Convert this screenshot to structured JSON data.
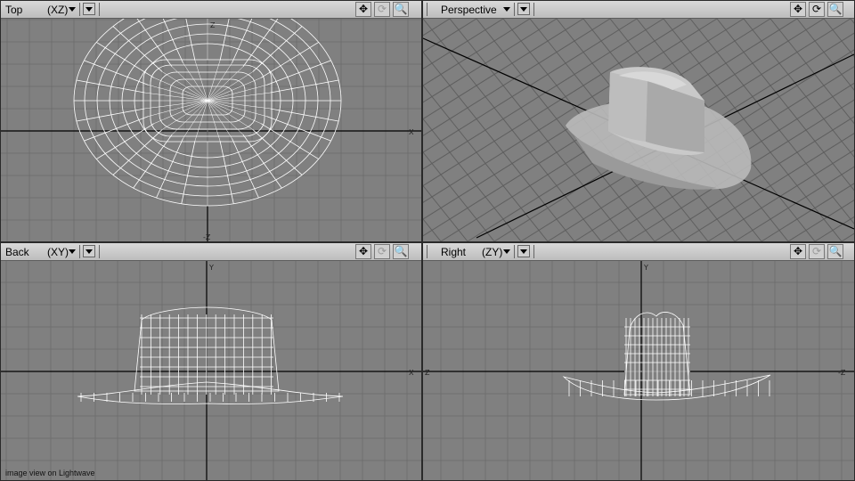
{
  "viewports": {
    "top": {
      "name": "Top",
      "axes": "(XZ)"
    },
    "persp": {
      "name": "Perspective",
      "axes": ""
    },
    "back": {
      "name": "Back",
      "axes": "(XY)"
    },
    "right": {
      "name": "Right",
      "axes": "(ZY)"
    }
  },
  "tools": {
    "move": "✥",
    "rotate": "⟳",
    "zoom": "🔍"
  },
  "axis_labels": {
    "x": "X",
    "y": "Y",
    "z": "Z",
    "neg_z": "-Z"
  },
  "caption": "image view on Lightwave",
  "colors": {
    "viewport_bg": "#808080",
    "grid": "#6f6f6f",
    "axis": "#000000",
    "wire": "#ffffff",
    "titlebar": "#c8c8c8"
  }
}
